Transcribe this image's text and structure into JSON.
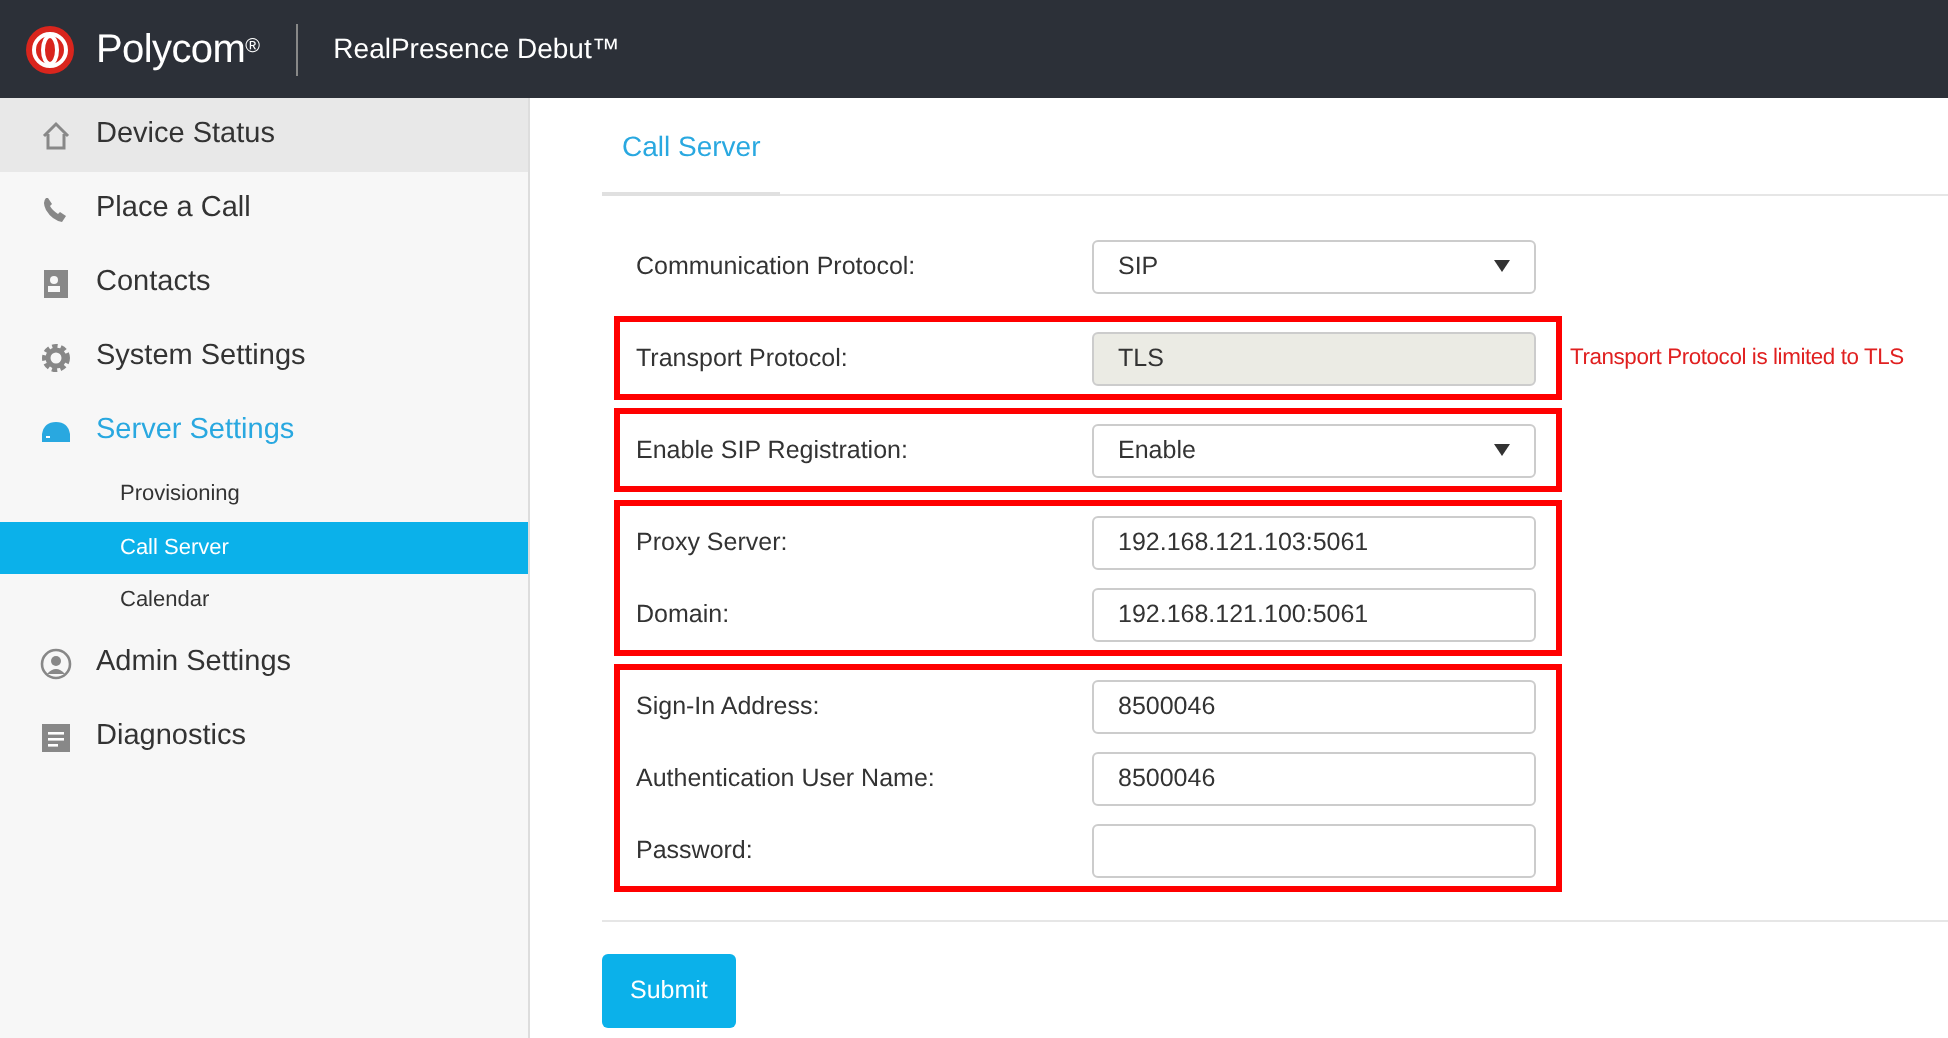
{
  "header": {
    "brand": "Polycom",
    "brand_mark": "®",
    "product": "RealPresence Debut™"
  },
  "sidebar": {
    "items": [
      {
        "label": "Device Status",
        "hovered": true,
        "selected": false
      },
      {
        "label": "Place a Call",
        "hovered": false,
        "selected": false
      },
      {
        "label": "Contacts",
        "hovered": false,
        "selected": false
      },
      {
        "label": "System Settings",
        "hovered": false,
        "selected": false
      },
      {
        "label": "Server Settings",
        "hovered": false,
        "selected": true,
        "children": [
          {
            "label": "Provisioning",
            "selected": false
          },
          {
            "label": "Call Server",
            "selected": true
          },
          {
            "label": "Calendar",
            "selected": false
          }
        ]
      },
      {
        "label": "Admin Settings",
        "hovered": false,
        "selected": false
      },
      {
        "label": "Diagnostics",
        "hovered": false,
        "selected": false
      }
    ]
  },
  "tab": {
    "label": "Call Server",
    "selected": true
  },
  "groups": [
    {
      "highlighted": false,
      "fields": [
        {
          "label": "Communication Protocol:",
          "kind": "select",
          "value": "SIP"
        }
      ]
    },
    {
      "highlighted": true,
      "fields": [
        {
          "label": "Transport Protocol:",
          "kind": "readonly",
          "value": "TLS",
          "message": "Transport Protocol is limited to TLS"
        }
      ]
    },
    {
      "highlighted": true,
      "fields": [
        {
          "label": "Enable SIP Registration:",
          "kind": "select",
          "value": "Enable"
        }
      ]
    },
    {
      "highlighted": true,
      "fields": [
        {
          "label": "Proxy Server:",
          "kind": "text",
          "value": "192.168.121.103:5061"
        },
        {
          "label": "Domain:",
          "kind": "text",
          "value": "192.168.121.100:5061"
        }
      ]
    },
    {
      "highlighted": true,
      "fields": [
        {
          "label": "Sign-In Address:",
          "kind": "text",
          "value": "8500046"
        },
        {
          "label": "Authentication User Name:",
          "kind": "text",
          "value": "8500046"
        },
        {
          "label": "Password:",
          "kind": "password"
        }
      ]
    }
  ],
  "submit": "Submit"
}
